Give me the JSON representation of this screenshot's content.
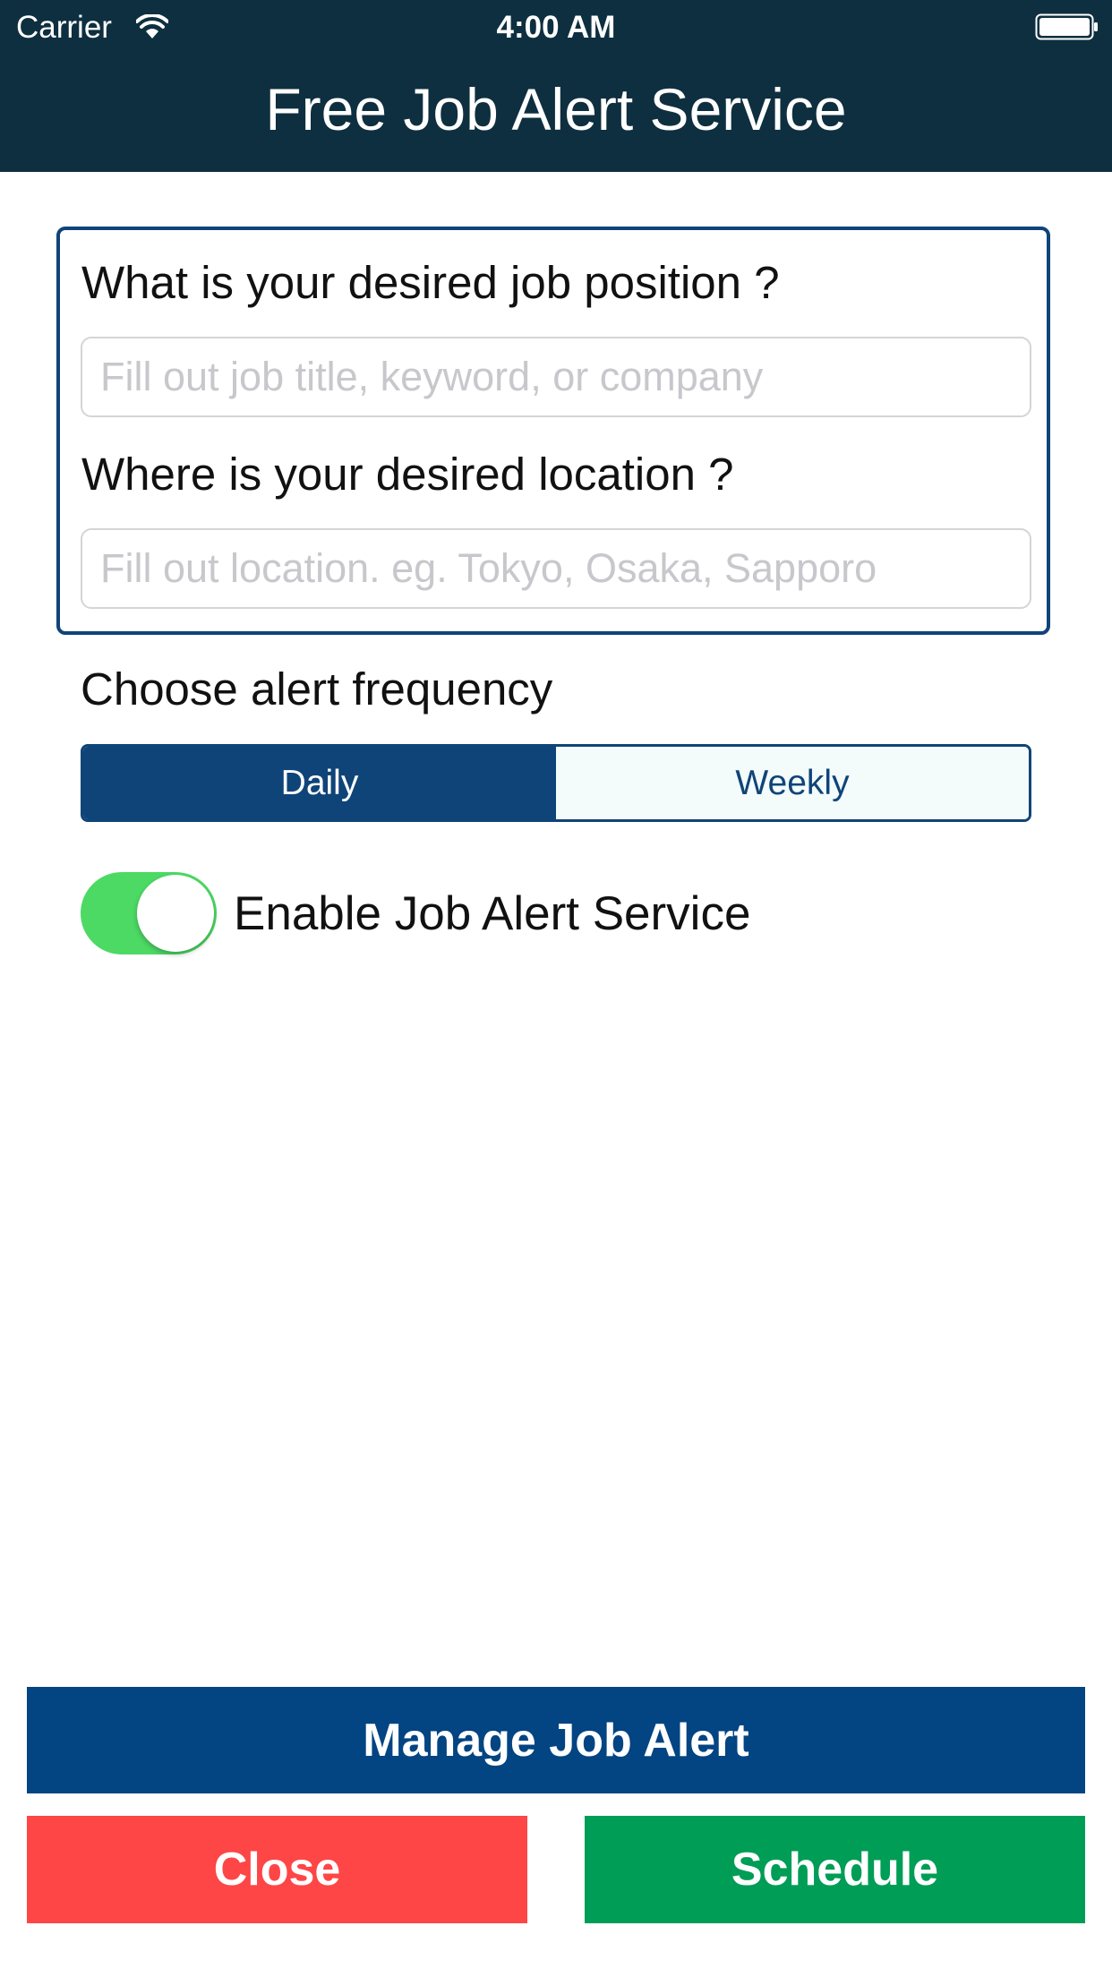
{
  "status_bar": {
    "carrier": "Carrier",
    "time": "4:00 AM",
    "wifi_icon": "wifi-icon",
    "battery_icon": "battery-icon"
  },
  "nav": {
    "title": "Free Job Alert Service"
  },
  "form": {
    "position_label": "What is your desired job position ?",
    "position_placeholder": "Fill out job title, keyword, or company",
    "position_value": "",
    "location_label": "Where is your desired location ?",
    "location_placeholder": "Fill out location. eg. Tokyo, Osaka, Sapporo",
    "location_value": ""
  },
  "frequency": {
    "label": "Choose alert frequency",
    "options": [
      "Daily",
      "Weekly"
    ],
    "selected": "Daily"
  },
  "toggle": {
    "label": "Enable Job Alert Service",
    "enabled": true
  },
  "buttons": {
    "manage": "Manage Job Alert",
    "close": "Close",
    "schedule": "Schedule"
  },
  "colors": {
    "nav_bg": "#0e2f3f",
    "primary": "#0f4478",
    "toggle_on": "#4cd964",
    "close": "#fe4646",
    "schedule": "#009d56"
  }
}
